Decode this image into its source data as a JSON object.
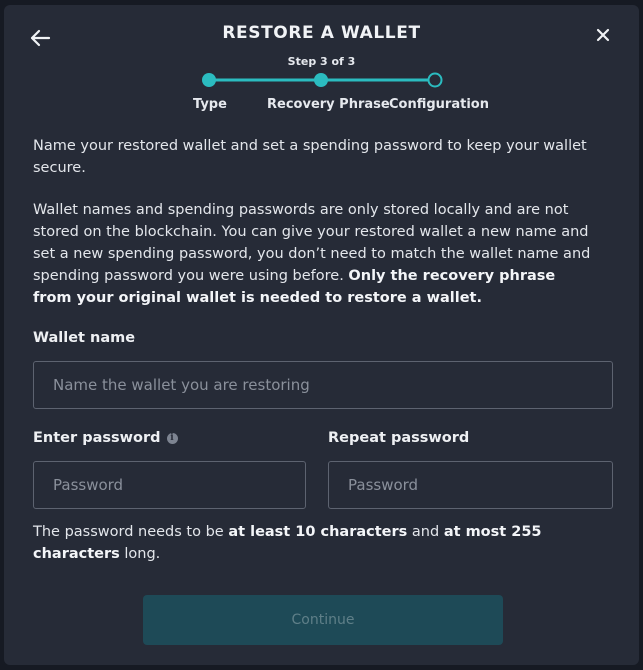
{
  "header": {
    "title": "RESTORE A WALLET",
    "step": "Step 3 of 3",
    "back_icon": "arrow-left-icon",
    "close_icon": "close-icon"
  },
  "stepper": {
    "steps": [
      {
        "label": "Type",
        "state": "done"
      },
      {
        "label": "Recovery Phrase",
        "state": "done"
      },
      {
        "label": "Configuration",
        "state": "current"
      }
    ],
    "accent_color": "#2bbcc0"
  },
  "intro": "Name your restored wallet and set a spending password to keep your wallet secure.",
  "info": {
    "text": "Wallet names and spending passwords are only stored locally and are not stored on the blockchain. You can give your restored wallet a new name and set a new spending password, you don’t need to match the wallet name and spending password you were using before. ",
    "bold": "Only the recovery phrase from your original wallet is needed to restore a wallet."
  },
  "wallet_name": {
    "label": "Wallet name",
    "placeholder": "Name the wallet you are restoring",
    "value": ""
  },
  "password": {
    "label": "Enter password",
    "placeholder": "Password",
    "value": "",
    "info_icon": "info-icon"
  },
  "repeat_password": {
    "label": "Repeat password",
    "placeholder": "Password",
    "value": ""
  },
  "hint": {
    "pre": "The password needs to be ",
    "b1": "at least 10 characters",
    "mid": " and ",
    "b2": "at most 255 characters",
    "post": " long."
  },
  "continue_label": "Continue"
}
